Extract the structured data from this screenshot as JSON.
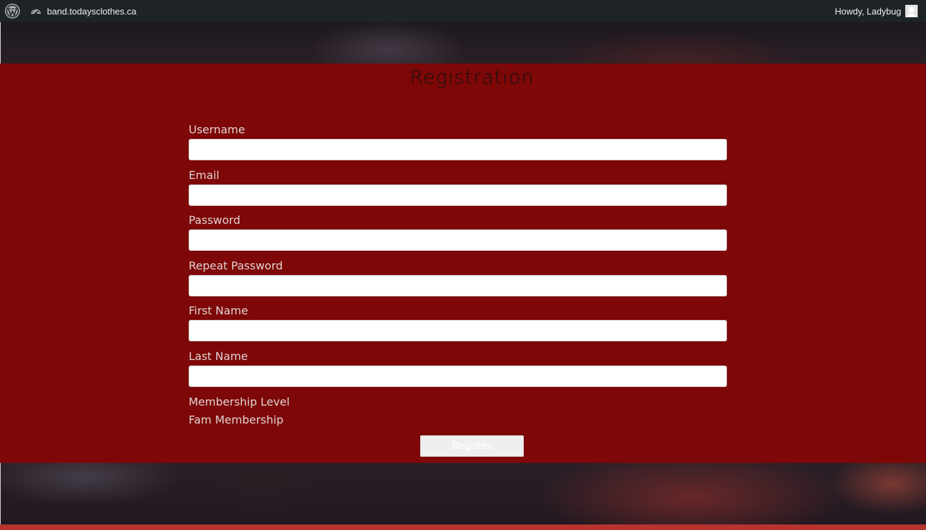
{
  "adminbar": {
    "logo_icon": "wordpress-logo-icon",
    "site_icon": "dashboard-icon",
    "site_name": "band.todaysclothes.ca",
    "greeting": "Howdy, Ladybug",
    "avatar_icon": "user-avatar-icon"
  },
  "registration": {
    "title": "Registration",
    "fields": [
      {
        "label": "Username",
        "value": "",
        "placeholder": ""
      },
      {
        "label": "Email",
        "value": "",
        "placeholder": ""
      },
      {
        "label": "Password",
        "value": "",
        "placeholder": ""
      },
      {
        "label": "Repeat Password",
        "value": "",
        "placeholder": ""
      },
      {
        "label": "First Name",
        "value": "",
        "placeholder": ""
      },
      {
        "label": "Last Name",
        "value": "",
        "placeholder": ""
      }
    ],
    "membership_label": "Membership Level",
    "membership_value": "Fam Membership",
    "submit_label": "Register"
  },
  "colors": {
    "panel_background": "#7e0707",
    "adminbar_background": "#1d2327",
    "label_text": "#e0d3d3",
    "bottom_strip": "#b8332e"
  }
}
